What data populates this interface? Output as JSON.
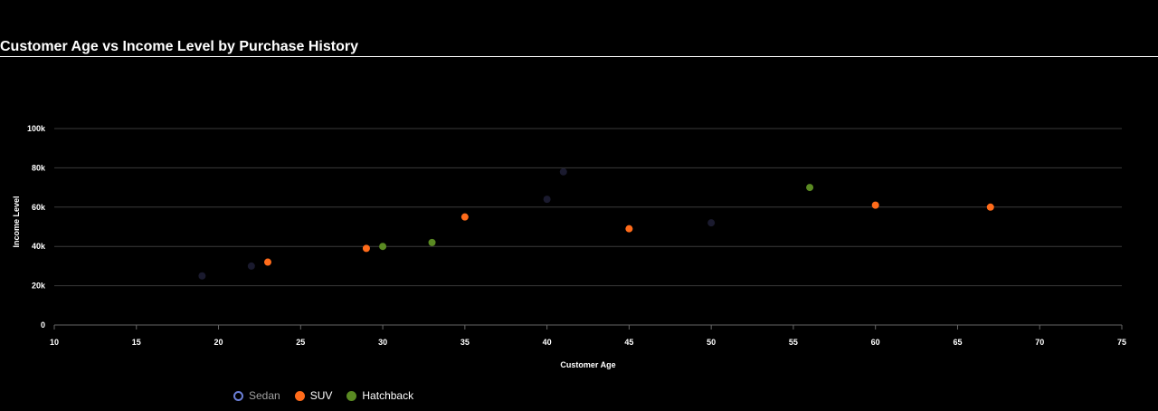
{
  "title": "Customer Age vs Income Level by Purchase History",
  "chart_data": {
    "type": "scatter",
    "xlabel": "Customer Age",
    "ylabel": "Income Level",
    "xlim": [
      10,
      75
    ],
    "ylim": [
      0,
      100000
    ],
    "x_ticks": [
      "10",
      "15",
      "20",
      "25",
      "30",
      "35",
      "40",
      "45",
      "50",
      "55",
      "60",
      "65",
      "70",
      "75"
    ],
    "y_ticks": [
      "0",
      "20k",
      "40k",
      "60k",
      "80k",
      "100k"
    ],
    "x_tick_values": [
      10,
      15,
      20,
      25,
      30,
      35,
      40,
      45,
      50,
      55,
      60,
      65,
      70,
      75
    ],
    "y_tick_values": [
      0,
      20000,
      40000,
      60000,
      80000,
      100000
    ],
    "grid": "horizontal",
    "legend_position": "bottom-left",
    "series": [
      {
        "name": "Sedan",
        "color": "#1a1a2e",
        "legend_color": "#6b7fd6",
        "legend_style": "ring",
        "points": [
          [
            19,
            25000
          ],
          [
            22,
            30000
          ],
          [
            40,
            64000
          ],
          [
            41,
            78000
          ],
          [
            50,
            52000
          ]
        ]
      },
      {
        "name": "SUV",
        "color": "#ff6b1a",
        "legend_color": "#ff6b1a",
        "legend_style": "filled",
        "points": [
          [
            23,
            32000
          ],
          [
            29,
            39000
          ],
          [
            35,
            55000
          ],
          [
            45,
            49000
          ],
          [
            60,
            61000
          ],
          [
            67,
            60000
          ]
        ]
      },
      {
        "name": "Hatchback",
        "color": "#5a8a22",
        "legend_color": "#5a8a22",
        "legend_style": "filled",
        "points": [
          [
            30,
            40000
          ],
          [
            33,
            42000
          ],
          [
            56,
            70000
          ]
        ]
      }
    ]
  }
}
